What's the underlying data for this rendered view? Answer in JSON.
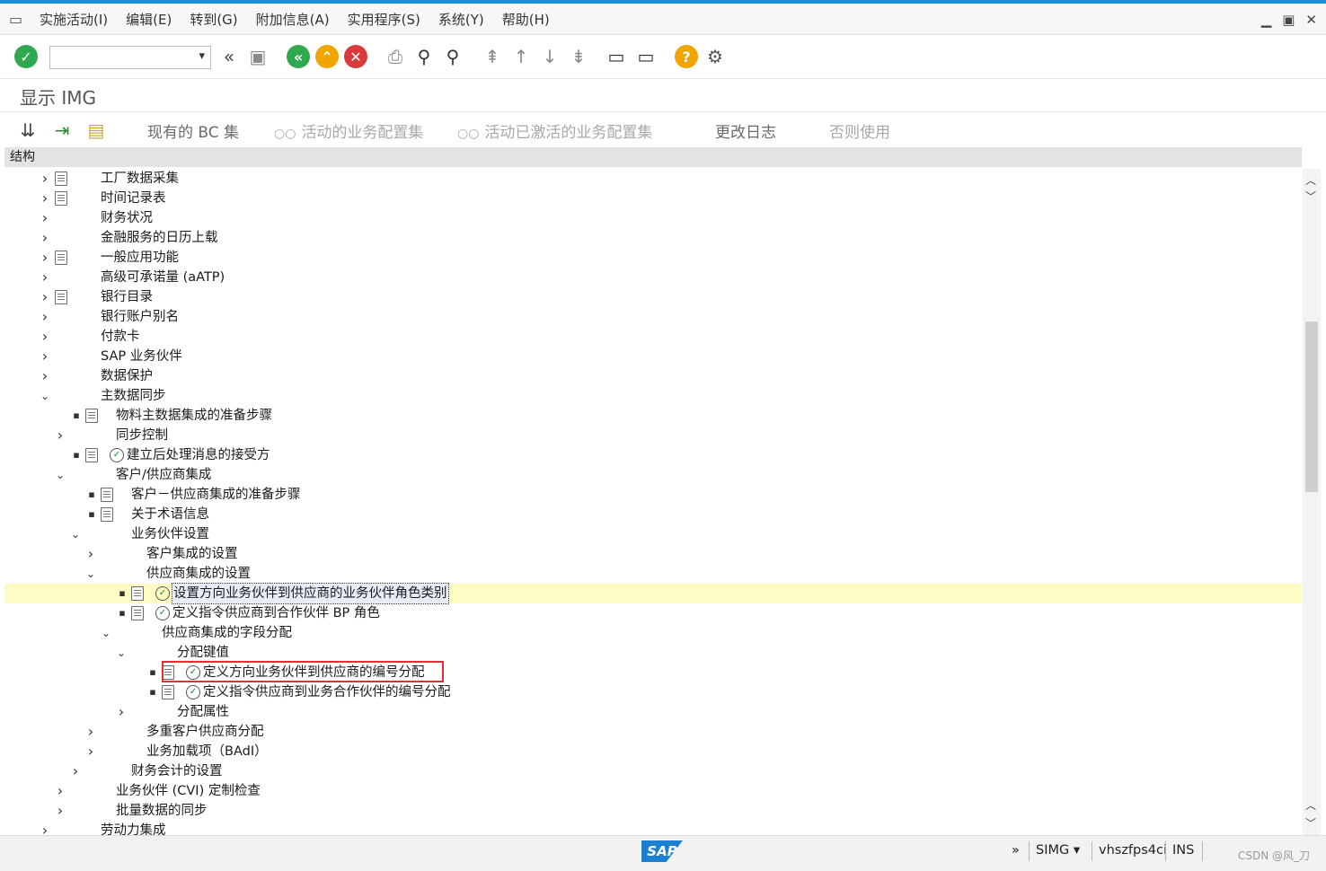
{
  "menubar": {
    "items": [
      "实施活动(I)",
      "编辑(E)",
      "转到(G)",
      "附加信息(A)",
      "实用程序(S)",
      "系统(Y)",
      "帮助(H)"
    ]
  },
  "toolbar": {
    "command_value": ""
  },
  "page": {
    "title": "显示 IMG"
  },
  "app_toolbar": {
    "bc_sets": "现有的 BC 集",
    "active_sets": "活动的业务配置集",
    "activated_sets": "活动已激活的业务配置集",
    "change_log": "更改日志",
    "where_used": "否则使用"
  },
  "structure": {
    "header": "结构",
    "rows": [
      {
        "label": "工厂数据采集",
        "toggle": "collapsed",
        "doc": true,
        "exec": false,
        "bullet": false
      },
      {
        "label": "时间记录表",
        "toggle": "collapsed",
        "doc": true,
        "exec": false,
        "bullet": false
      },
      {
        "label": "财务状况",
        "toggle": "collapsed",
        "doc": false,
        "exec": false,
        "bullet": false
      },
      {
        "label": "金融服务的日历上载",
        "toggle": "collapsed",
        "doc": false,
        "exec": false,
        "bullet": false
      },
      {
        "label": "一般应用功能",
        "toggle": "collapsed",
        "doc": true,
        "exec": false,
        "bullet": false
      },
      {
        "label": "高级可承诺量 (aATP)",
        "toggle": "collapsed",
        "doc": false,
        "exec": false,
        "bullet": false
      },
      {
        "label": "银行目录",
        "toggle": "collapsed",
        "doc": true,
        "exec": false,
        "bullet": false
      },
      {
        "label": "银行账户别名",
        "toggle": "collapsed",
        "doc": false,
        "exec": false,
        "bullet": false
      },
      {
        "label": "付款卡",
        "toggle": "collapsed",
        "doc": false,
        "exec": false,
        "bullet": false
      },
      {
        "label": "SAP 业务伙伴",
        "toggle": "collapsed",
        "doc": false,
        "exec": false,
        "bullet": false
      },
      {
        "label": "数据保护",
        "toggle": "collapsed",
        "doc": false,
        "exec": false,
        "bullet": false
      },
      {
        "label": "主数据同步",
        "toggle": "expanded",
        "doc": false,
        "exec": false,
        "bullet": false
      },
      {
        "label": "物料主数据集成的准备步骤",
        "toggle": "none",
        "doc": true,
        "exec": false,
        "bullet": true
      },
      {
        "label": "同步控制",
        "toggle": "collapsed",
        "doc": false,
        "exec": false,
        "bullet": false
      },
      {
        "label": "建立后处理消息的接受方",
        "toggle": "none",
        "doc": true,
        "exec": true,
        "bullet": true
      },
      {
        "label": "客户/供应商集成",
        "toggle": "expanded",
        "doc": false,
        "exec": false,
        "bullet": false
      },
      {
        "label": "客户－供应商集成的准备步骤",
        "toggle": "none",
        "doc": true,
        "exec": false,
        "bullet": true
      },
      {
        "label": "关于术语信息",
        "toggle": "none",
        "doc": true,
        "exec": false,
        "bullet": true
      },
      {
        "label": "业务伙伴设置",
        "toggle": "expanded",
        "doc": false,
        "exec": false,
        "bullet": false
      },
      {
        "label": "客户集成的设置",
        "toggle": "collapsed",
        "doc": false,
        "exec": false,
        "bullet": false
      },
      {
        "label": "供应商集成的设置",
        "toggle": "expanded",
        "doc": false,
        "exec": false,
        "bullet": false
      },
      {
        "label": "设置方向业务伙伴到供应商的业务伙伴角色类别",
        "toggle": "none",
        "doc": true,
        "exec": true,
        "bullet": true
      },
      {
        "label": "定义指令供应商到合作伙伴 BP 角色",
        "toggle": "none",
        "doc": true,
        "exec": true,
        "bullet": true
      },
      {
        "label": "供应商集成的字段分配",
        "toggle": "expanded",
        "doc": false,
        "exec": false,
        "bullet": false
      },
      {
        "label": "分配键值",
        "toggle": "expanded",
        "doc": false,
        "exec": false,
        "bullet": false
      },
      {
        "label": "定义方向业务伙伴到供应商的编号分配",
        "toggle": "none",
        "doc": true,
        "exec": true,
        "bullet": true
      },
      {
        "label": "定义指令供应商到业务合作伙伴的编号分配",
        "toggle": "none",
        "doc": true,
        "exec": true,
        "bullet": true
      },
      {
        "label": "分配属性",
        "toggle": "collapsed",
        "doc": false,
        "exec": false,
        "bullet": false
      },
      {
        "label": "多重客户供应商分配",
        "toggle": "collapsed",
        "doc": false,
        "exec": false,
        "bullet": false
      },
      {
        "label": "业务加载项（BAdI）",
        "toggle": "collapsed",
        "doc": false,
        "exec": false,
        "bullet": false
      },
      {
        "label": "财务会计的设置",
        "toggle": "collapsed",
        "doc": false,
        "exec": false,
        "bullet": false
      },
      {
        "label": "业务伙伴 (CVI) 定制检查",
        "toggle": "collapsed",
        "doc": false,
        "exec": false,
        "bullet": false
      },
      {
        "label": "批量数据的同步",
        "toggle": "collapsed",
        "doc": false,
        "exec": false,
        "bullet": false
      },
      {
        "label": "劳动力集成",
        "toggle": "collapsed",
        "doc": false,
        "exec": false,
        "bullet": false
      }
    ]
  },
  "statusbar": {
    "sap_logo": "SAP",
    "more": "»",
    "transaction": "SIMG",
    "server": "vhszfps4ci",
    "mode": "INS",
    "watermark": "CSDN @风_刀"
  },
  "colors": {
    "accent": "#1d8fd6",
    "highlight_row": "#fcfcc4",
    "red_box": "#e03030"
  }
}
